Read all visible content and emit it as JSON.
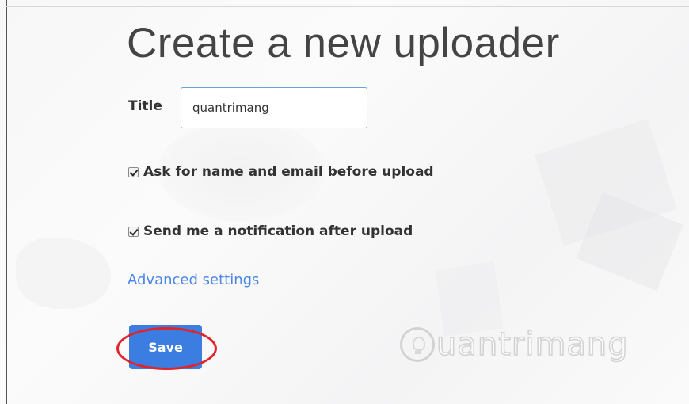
{
  "page": {
    "title": "Create a new uploader"
  },
  "form": {
    "title_label": "Title",
    "title_value": "quantrimang",
    "ask_option": {
      "label": "Ask for name and email before upload",
      "checked": true
    },
    "notify_option": {
      "label": "Send me a notification after upload",
      "checked": true
    },
    "advanced_link": "Advanced settings",
    "save_label": "Save"
  },
  "watermark": {
    "text": "uantrimang",
    "logo_icon": "lightbulb-icon"
  },
  "colors": {
    "accent": "#3b7de0",
    "link": "#4a86e8",
    "highlight": "#e0242b",
    "input_border": "#6f9ede",
    "text": "#333333"
  }
}
